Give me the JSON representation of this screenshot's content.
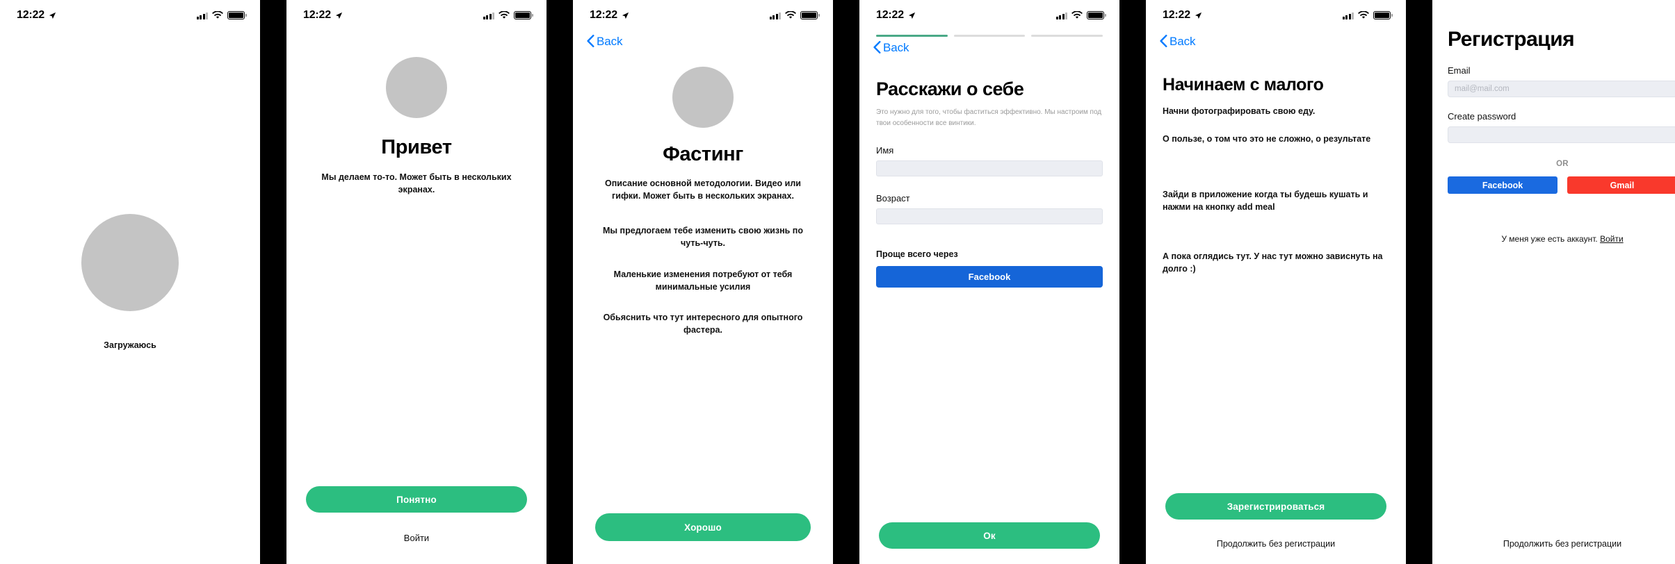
{
  "statusbar": {
    "time": "12:22",
    "icons": [
      "location-arrow-icon",
      "cellular-signal-icon",
      "wifi-icon",
      "battery-icon"
    ]
  },
  "colors": {
    "green": "#2cbe80",
    "facebook_blue": "#1565d8",
    "facebook_blue_alt": "#1a6ae0",
    "gmail_red": "#f9392c",
    "ios_link_blue": "#007aff",
    "placeholder_gray": "#c4c4c4",
    "field_bg": "#eceef3",
    "progress_active": "#4aa987",
    "progress_inactive": "#dcdcdc"
  },
  "screens": [
    {
      "name": "splash",
      "loading_label": "Загружаюсь"
    },
    {
      "name": "welcome",
      "title": "Привет",
      "body": "Мы делаем то-то. Может быть в нескольких экранах.",
      "primary_button": "Понятно",
      "secondary_link": "Войти"
    },
    {
      "name": "fasting-intro",
      "back_label": "Back",
      "title": "Фастинг",
      "paragraphs": [
        "Описание основной методологии. Видео или гифки. Может быть в нескольких экранах.",
        "Мы предлогаем тебе изменить свою жизнь по чуть-чуть.",
        "Маленькие изменения потребуют от тебя минимальные усилия",
        "Обьяснить что тут интересного для опытного фастера."
      ],
      "primary_button": "Хорошо"
    },
    {
      "name": "about-you",
      "back_label": "Back",
      "progress": {
        "steps": 3,
        "active": 1
      },
      "title": "Расскажи о себе",
      "subtitle": "Это нужно для того, чтобы фаститься эффективно. Мы настроим под твои особенности все винтики.",
      "fields": [
        {
          "label": "Имя",
          "value": "",
          "placeholder": ""
        },
        {
          "label": "Возраст",
          "value": "",
          "placeholder": ""
        }
      ],
      "social_hint": "Проще всего через",
      "facebook_button": "Facebook",
      "primary_button": "Ок"
    },
    {
      "name": "start-small",
      "back_label": "Back",
      "title": "Начинаем с малого",
      "paragraphs": [
        "Начни фотографировать свою еду.",
        "О пользе, о том что это не сложно, о результате",
        "Зайди в приложение когда ты будешь кушать и нажми на кнопку add meal",
        "А пока оглядись тут. У нас тут можно зависнуть на долго :)"
      ],
      "primary_button": "Зарегистрироваться",
      "skip_link": "Продолжить без регистрации"
    },
    {
      "name": "registration",
      "title": "Регистрация",
      "fields": [
        {
          "label": "Email",
          "value": "",
          "placeholder": "mail@mail.com"
        },
        {
          "label": "Create password",
          "value": "",
          "placeholder": ""
        }
      ],
      "divider_label": "OR",
      "facebook_button": "Facebook",
      "gmail_button": "Gmail",
      "account_text": "У меня уже есть аккаунт.",
      "account_link": "Войти",
      "skip_link": "Продолжить без регистрации"
    }
  ]
}
